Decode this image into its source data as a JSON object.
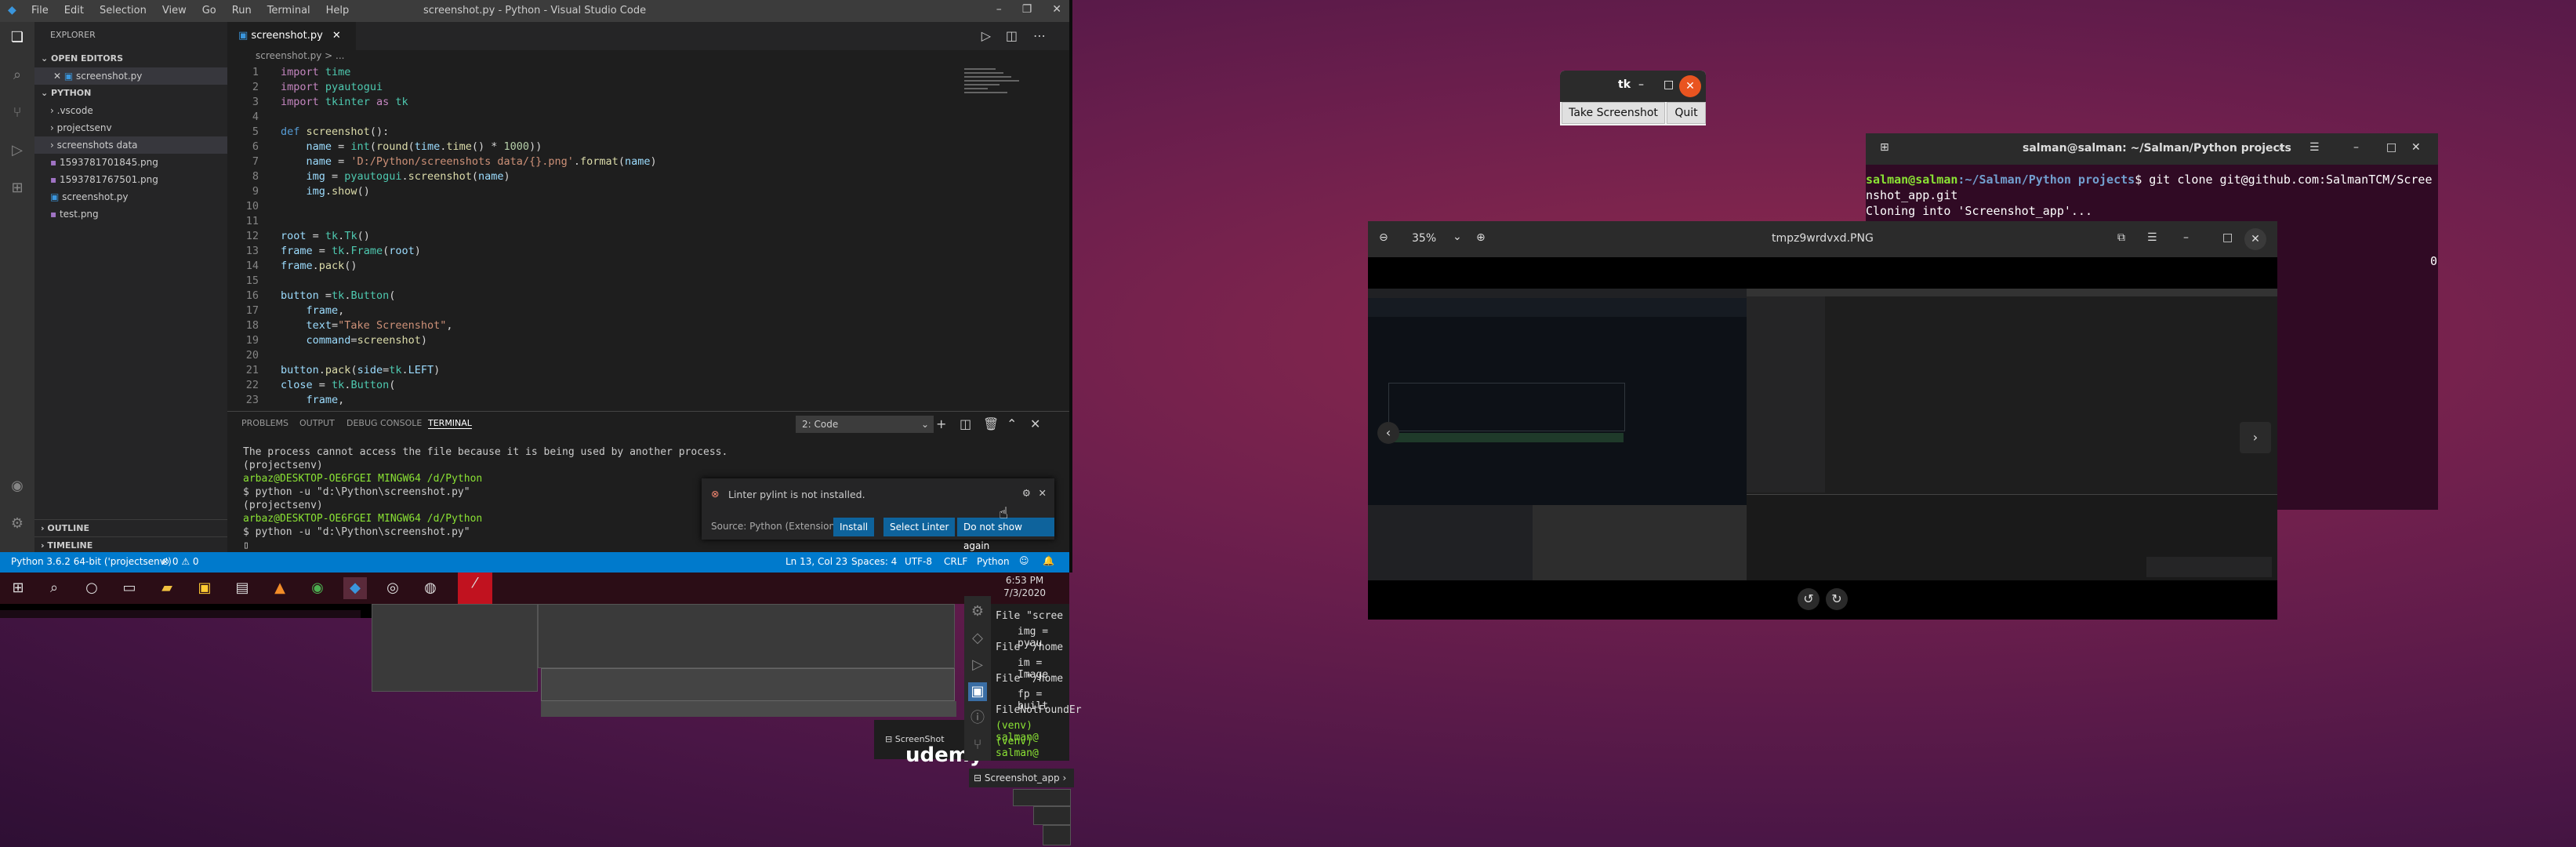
{
  "vscode": {
    "title": "screenshot.py - Python - Visual Studio Code",
    "menu": [
      "File",
      "Edit",
      "Selection",
      "View",
      "Go",
      "Run",
      "Terminal",
      "Help"
    ],
    "explorer": {
      "header": "EXPLORER",
      "open_editors": "OPEN EDITORS",
      "open_file": "screenshot.py",
      "folder": "PYTHON",
      "items": [
        ".vscode",
        "projectsenv",
        "screenshots data",
        "1593781701845.png",
        "1593781767501.png",
        "screenshot.py",
        "test.png"
      ],
      "outline": "OUTLINE",
      "timeline": "TIMELINE"
    },
    "tab_label": "screenshot.py",
    "breadcrumb": "screenshot.py > ...",
    "code_lines": [
      {
        "n": "1",
        "t": "import time"
      },
      {
        "n": "2",
        "t": "import pyautogui"
      },
      {
        "n": "3",
        "t": "import tkinter as tk"
      },
      {
        "n": "4",
        "t": ""
      },
      {
        "n": "5",
        "t": "def screenshot():"
      },
      {
        "n": "6",
        "t": "    name = int(round(time.time() * 1000))"
      },
      {
        "n": "7",
        "t": "    name = 'D:/Python/screenshots data/{}.png'.format(name)"
      },
      {
        "n": "8",
        "t": "    img = pyautogui.screenshot(name)"
      },
      {
        "n": "9",
        "t": "    img.show()"
      },
      {
        "n": "10",
        "t": ""
      },
      {
        "n": "11",
        "t": ""
      },
      {
        "n": "12",
        "t": "root = tk.Tk()"
      },
      {
        "n": "13",
        "t": "frame = tk.Frame(root)"
      },
      {
        "n": "14",
        "t": "frame.pack()"
      },
      {
        "n": "15",
        "t": ""
      },
      {
        "n": "16",
        "t": "button = tk.Button("
      },
      {
        "n": "17",
        "t": "    frame,"
      },
      {
        "n": "18",
        "t": "    text=\"Take Screenshot\","
      },
      {
        "n": "19",
        "t": "    command=screenshot)"
      },
      {
        "n": "20",
        "t": ""
      },
      {
        "n": "21",
        "t": "button.pack(side=tk.LEFT)"
      },
      {
        "n": "22",
        "t": "close = tk.Button("
      },
      {
        "n": "23",
        "t": "    frame,"
      }
    ],
    "panel_tabs": [
      "PROBLEMS",
      "OUTPUT",
      "DEBUG CONSOLE",
      "TERMINAL"
    ],
    "terminal_selector": "2: Code",
    "terminal_lines": [
      "The process cannot access the file because it is being used by another process.",
      "(projectsenv)",
      "arbaz@DESKTOP-OE6FGEI MINGW64 /d/Python",
      "$ python -u \"d:\\Python\\screenshot.py\"",
      "(projectsenv)",
      "arbaz@DESKTOP-OE6FGEI MINGW64 /d/Python",
      "$ python -u \"d:\\Python\\screenshot.py\""
    ],
    "notification": {
      "message": "Linter pylint is not installed.",
      "source": "Source: Python (Extension)",
      "buttons": [
        "Install",
        "Select Linter",
        "Do not show again"
      ]
    },
    "status": {
      "interpreter": "Python 3.6.2 64-bit ('projectsenv')",
      "problems": "⊗ 0 ⚠ 0",
      "position": "Ln 13, Col 23",
      "spaces": "Spaces: 4",
      "encoding": "UTF-8",
      "eol": "CRLF",
      "language": "Python"
    }
  },
  "win_taskbar": {
    "time": "6:53 PM",
    "date": "7/3/2020"
  },
  "ghost_terminal": {
    "lines": [
      "File \"scree",
      "img = pyau",
      "File \"/home",
      "im = Image",
      "File \"/home",
      "fp = built",
      "FileNotFoundEr",
      "(venv) salman@",
      "(venv) salman@"
    ],
    "tab1": "ScreenShot",
    "tab2": "Screenshot_app",
    "udemy": "udemy"
  },
  "tk_window": {
    "title": "tk",
    "take_label": "Take Screenshot",
    "quit_label": "Quit"
  },
  "ubuntu_terminal": {
    "title": "salman@salman: ~/Salman/Python projects",
    "prompt_user": "salman@salman",
    "prompt_path": ":~/Salman/Python projects",
    "command": "$ git clone git@github.com:SalmanTCM/Scree",
    "line2": "nshot_app.git",
    "line3": "Cloning into 'Screenshot_app'...",
    "right_char": "0"
  },
  "image_viewer": {
    "zoom": "35%",
    "filename": "tmpz9wrdvxd.PNG"
  },
  "colors": {
    "vscode_status": "#007acc",
    "ubuntu_bg": "#300a24",
    "accent_orange": "#e95420"
  }
}
